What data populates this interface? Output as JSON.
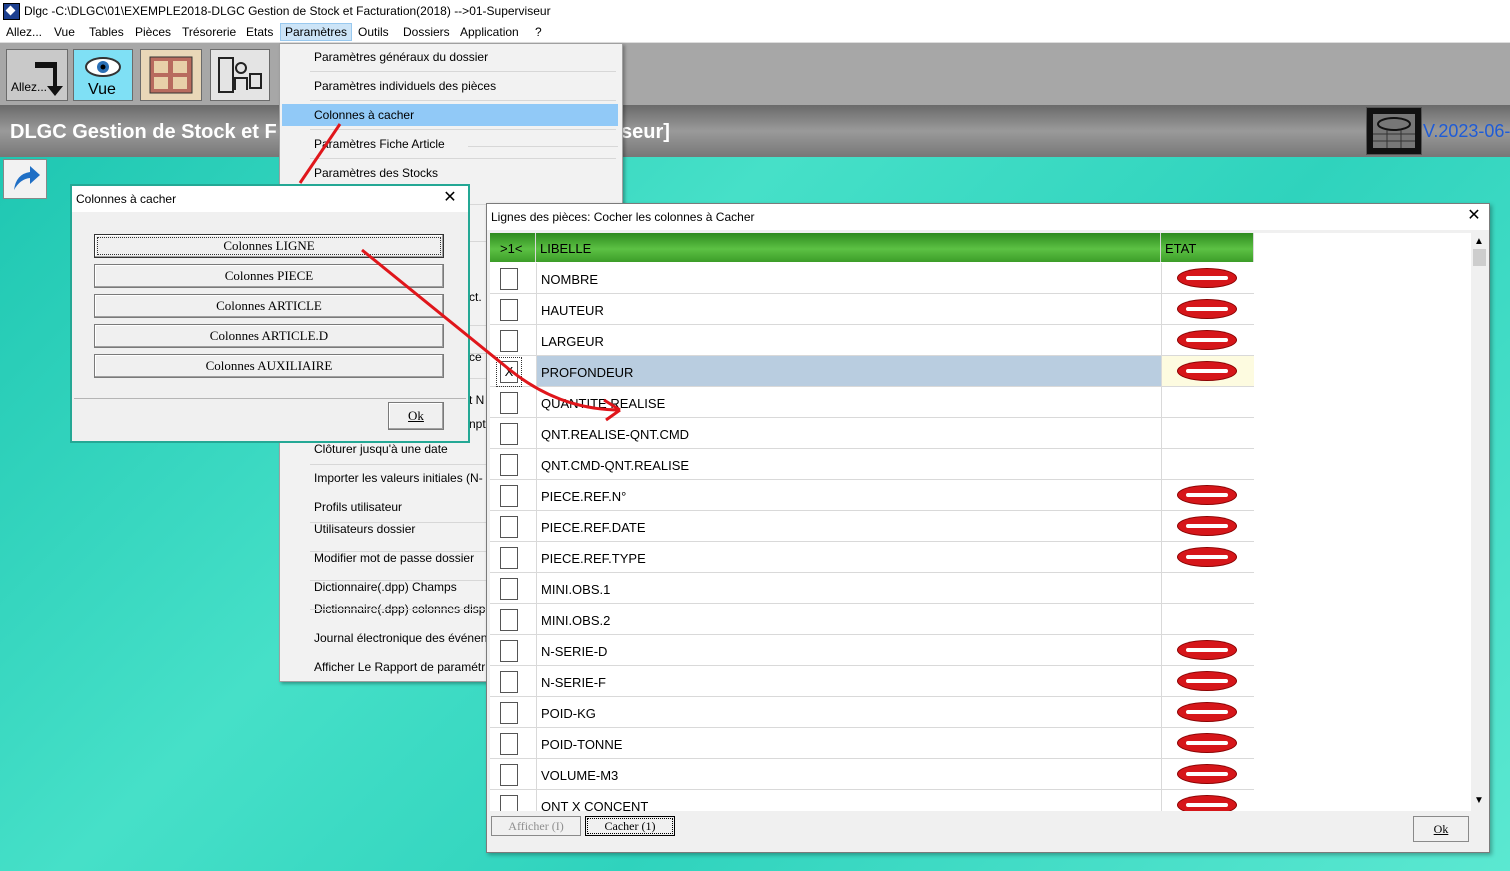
{
  "window_title": "Dlgc -C:\\DLGC\\01\\EXEMPLE2018-DLGC Gestion de Stock et Facturation(2018) -->01-Superviseur",
  "menubar": [
    "Allez...",
    "Vue",
    "Tables",
    "Pièces",
    "Trésorerie",
    "Etats",
    "Paramètres",
    "Outils",
    "Dossiers",
    "Application",
    "?"
  ],
  "toolbar": {
    "allez_label": "Allez...",
    "vue_label": "Vue"
  },
  "banner": {
    "title": "DLGC Gestion de Stock et F",
    "title_tail": "seur]",
    "version": "V.2023-06-"
  },
  "dropdown": {
    "items": [
      "Paramètres généraux du dossier",
      "Paramètres individuels des pièces",
      "Colonnes à cacher",
      "Paramètres Fiche Article",
      "Paramètres des Stocks",
      "Clôturer jusqu'à une date",
      "Importer les valeurs initiales (N-",
      "Profils utilisateur",
      "Utilisateurs dossier",
      "Modifier mot de passe dossier",
      "Dictionnaire(.dpp) Champs",
      "Dictionnaire(.dpp) colonnes disp",
      "Journal électronique des événen",
      "Afficher Le Rapport de paramétr"
    ],
    "peek": [
      "ct.",
      "ce",
      "t N",
      "npt"
    ]
  },
  "dialog1": {
    "title": "Colonnes à cacher",
    "buttons": [
      "Colonnes LIGNE",
      "Colonnes PIECE",
      "Colonnes ARTICLE",
      "Colonnes ARTICLE.D",
      "Colonnes AUXILIAIRE"
    ],
    "ok": "Ok"
  },
  "dialog2": {
    "title": "Lignes des pièces: Cocher les colonnes à Cacher",
    "headers": {
      "col1": ">1<",
      "libelle": "LIBELLE",
      "etat": "ETAT"
    },
    "rows": [
      {
        "label": "NOMBRE",
        "checked": "",
        "hidden": true
      },
      {
        "label": "HAUTEUR",
        "checked": "",
        "hidden": true
      },
      {
        "label": "LARGEUR",
        "checked": "",
        "hidden": true
      },
      {
        "label": "PROFONDEUR",
        "checked": "X",
        "hidden": true
      },
      {
        "label": "QUANTITE REALISE",
        "checked": "",
        "hidden": false
      },
      {
        "label": "QNT.REALISE-QNT.CMD",
        "checked": "",
        "hidden": false
      },
      {
        "label": "QNT.CMD-QNT.REALISE",
        "checked": "",
        "hidden": false
      },
      {
        "label": "PIECE.REF.N°",
        "checked": "",
        "hidden": true
      },
      {
        "label": "PIECE.REF.DATE",
        "checked": "",
        "hidden": true
      },
      {
        "label": "PIECE.REF.TYPE",
        "checked": "",
        "hidden": true
      },
      {
        "label": "MINI.OBS.1",
        "checked": "",
        "hidden": false
      },
      {
        "label": "MINI.OBS.2",
        "checked": "",
        "hidden": false
      },
      {
        "label": "N-SERIE-D",
        "checked": "",
        "hidden": true
      },
      {
        "label": "N-SERIE-F",
        "checked": "",
        "hidden": true
      },
      {
        "label": "POID-KG",
        "checked": "",
        "hidden": true
      },
      {
        "label": "POID-TONNE",
        "checked": "",
        "hidden": true
      },
      {
        "label": "VOLUME-M3",
        "checked": "",
        "hidden": true
      },
      {
        "label": "QNT X CONCENT",
        "checked": "",
        "hidden": true
      }
    ],
    "btn_afficher": "Afficher (I)",
    "btn_cacher": "Cacher (1)",
    "ok": "Ok"
  },
  "colors": {
    "annotation_arrow": "#e0161b",
    "selection": "#91c9f7",
    "header_green": "#3c9d28"
  }
}
